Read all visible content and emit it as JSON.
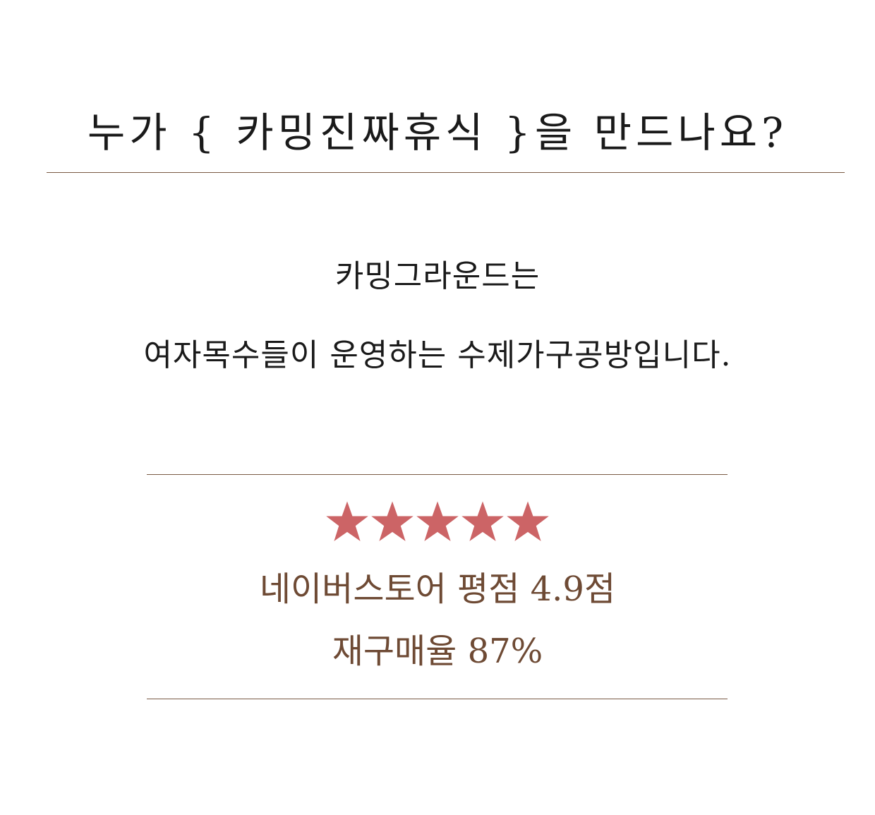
{
  "title": "누가 { 카밍진짜휴식 }을 만드나요?",
  "intro": {
    "line1": "카밍그라운드는",
    "line2": "여자목수들이 운영하는 수제가구공방입니다."
  },
  "rating": {
    "stars": 5,
    "max_stars": 5,
    "star_color": "#cc6466",
    "store_rating": "네이버스토어 평점 4.9점",
    "repurchase": "재구매율 87%"
  },
  "colors": {
    "text_dark": "#1a1a1a",
    "text_brown": "#6e4a34",
    "divider": "#7a5a44"
  }
}
